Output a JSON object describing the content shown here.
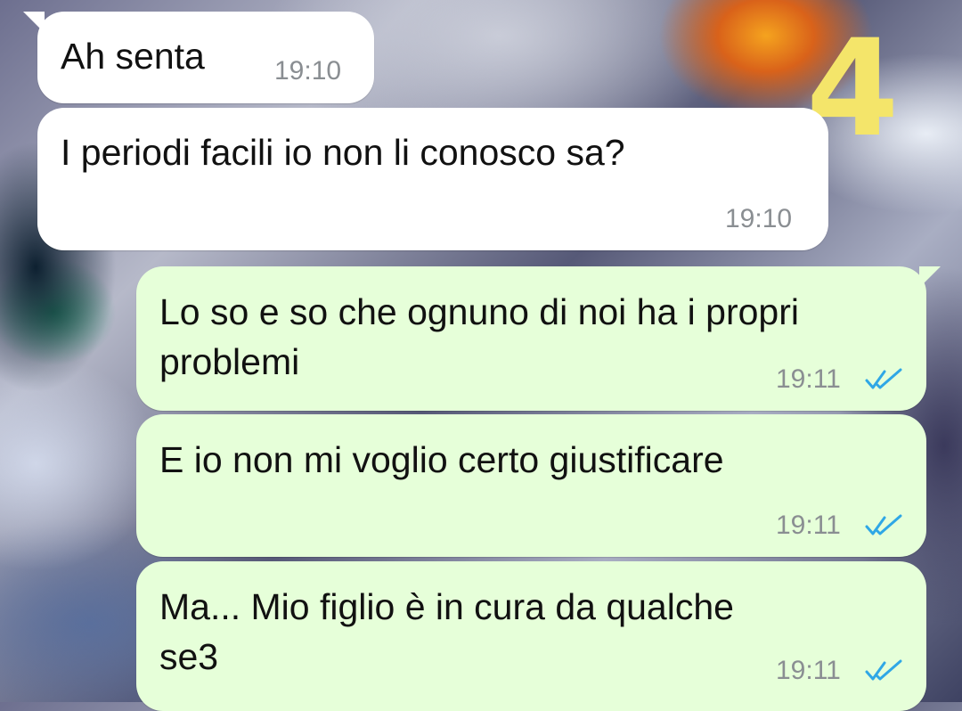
{
  "background": {
    "overlay_number": "4"
  },
  "colors": {
    "incoming_bubble": "#ffffff",
    "outgoing_bubble": "#e6ffd9",
    "timestamp": "#8a8e92",
    "read_ticks": "#2fa7e6",
    "overlay_number": "#f4e56a"
  },
  "messages": [
    {
      "direction": "incoming",
      "lines": [
        "Ah senta"
      ],
      "time": "19:10"
    },
    {
      "direction": "incoming",
      "lines": [
        "I periodi facili io non li conosco sa?"
      ],
      "time": "19:10"
    },
    {
      "direction": "outgoing",
      "lines": [
        "Lo so e so che ognuno di noi ha i propri",
        "problemi"
      ],
      "time": "19:11",
      "status_icon": "double-check-read-icon"
    },
    {
      "direction": "outgoing",
      "lines": [
        "E io non mi voglio certo giustificare"
      ],
      "time": "19:11",
      "status_icon": "double-check-read-icon"
    },
    {
      "direction": "outgoing",
      "lines": [
        "Ma... Mio figlio è in cura da qualche",
        "se3"
      ],
      "time": "19:11",
      "status_icon": "double-check-read-icon"
    }
  ]
}
